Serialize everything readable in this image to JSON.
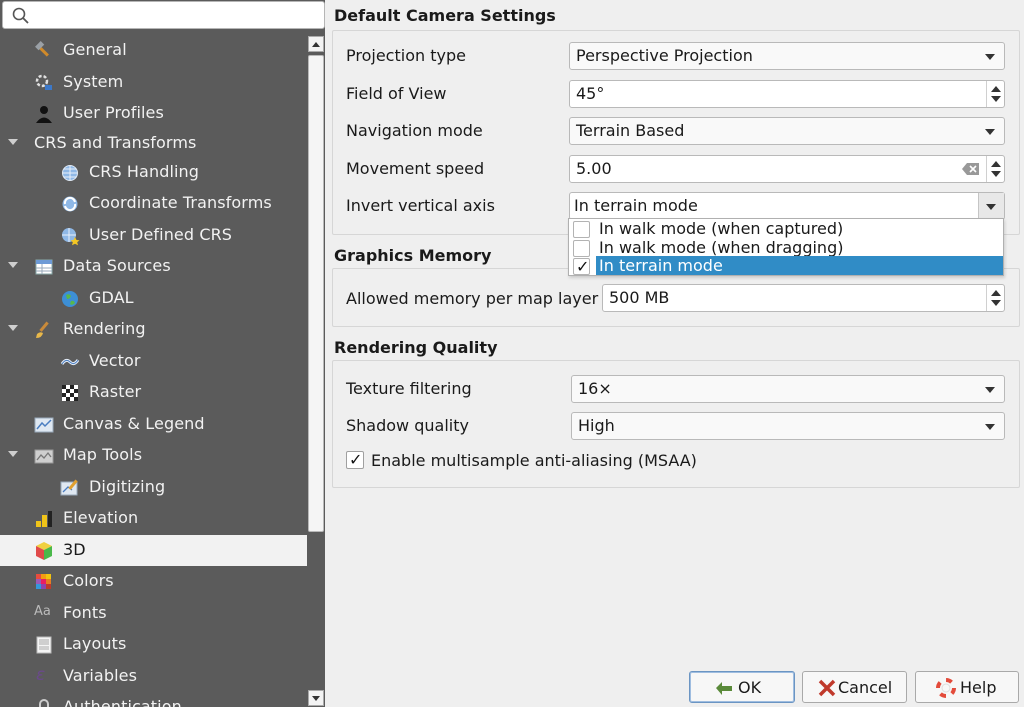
{
  "search": {
    "placeholder": ""
  },
  "sidebar": {
    "items": [
      {
        "label": "General",
        "icon": "hammer-icon"
      },
      {
        "label": "System",
        "icon": "system-gear-icon"
      },
      {
        "label": "User Profiles",
        "icon": "user-icon"
      },
      {
        "label": "CRS and Transforms",
        "icon": ""
      },
      {
        "label": "CRS Handling",
        "icon": "globe-icon"
      },
      {
        "label": "Coordinate Transforms",
        "icon": "transform-icon"
      },
      {
        "label": "User Defined CRS",
        "icon": "globe-star-icon"
      },
      {
        "label": "Data Sources",
        "icon": "table-icon"
      },
      {
        "label": "GDAL",
        "icon": "gdal-globe-icon"
      },
      {
        "label": "Rendering",
        "icon": "brush-icon"
      },
      {
        "label": "Vector",
        "icon": "vector-icon"
      },
      {
        "label": "Raster",
        "icon": "raster-icon"
      },
      {
        "label": "Canvas & Legend",
        "icon": "map-canvas-icon"
      },
      {
        "label": "Map Tools",
        "icon": "map-tools-icon"
      },
      {
        "label": "Digitizing",
        "icon": "digitizing-icon"
      },
      {
        "label": "Elevation",
        "icon": "elevation-icon"
      },
      {
        "label": "3D",
        "icon": "cube-3d-icon"
      },
      {
        "label": "Colors",
        "icon": "color-palette-icon"
      },
      {
        "label": "Fonts",
        "icon": "font-icon"
      },
      {
        "label": "Layouts",
        "icon": "layout-icon"
      },
      {
        "label": "Variables",
        "icon": "variables-icon"
      },
      {
        "label": "Authentication",
        "icon": "lock-icon"
      }
    ],
    "selected": "3D"
  },
  "camera": {
    "title": "Default Camera Settings",
    "projection_label": "Projection type",
    "projection_value": "Perspective Projection",
    "fov_label": "Field of View",
    "fov_value": "45°",
    "nav_label": "Navigation mode",
    "nav_value": "Terrain Based",
    "speed_label": "Movement speed",
    "speed_value": "5.00",
    "invert_label": "Invert vertical axis",
    "invert_value": "In terrain mode",
    "invert_options": [
      {
        "label": "In walk mode (when captured)",
        "checked": false
      },
      {
        "label": "In walk mode (when dragging)",
        "checked": false
      },
      {
        "label": "In terrain mode",
        "checked": true
      }
    ]
  },
  "memory": {
    "title": "Graphics Memory",
    "allowed_label": "Allowed memory per map layer",
    "allowed_value": "500 MB"
  },
  "quality": {
    "title": "Rendering Quality",
    "texture_label": "Texture filtering",
    "texture_value": "16×",
    "shadow_label": "Shadow quality",
    "shadow_value": "High",
    "msaa_label": "Enable multisample anti-aliasing (MSAA)",
    "msaa_checked": true
  },
  "buttons": {
    "ok": "OK",
    "cancel": "Cancel",
    "help": "Help"
  },
  "colors": {
    "sidebar_bg": "#5b5b5b",
    "selection": "#308cc6"
  }
}
